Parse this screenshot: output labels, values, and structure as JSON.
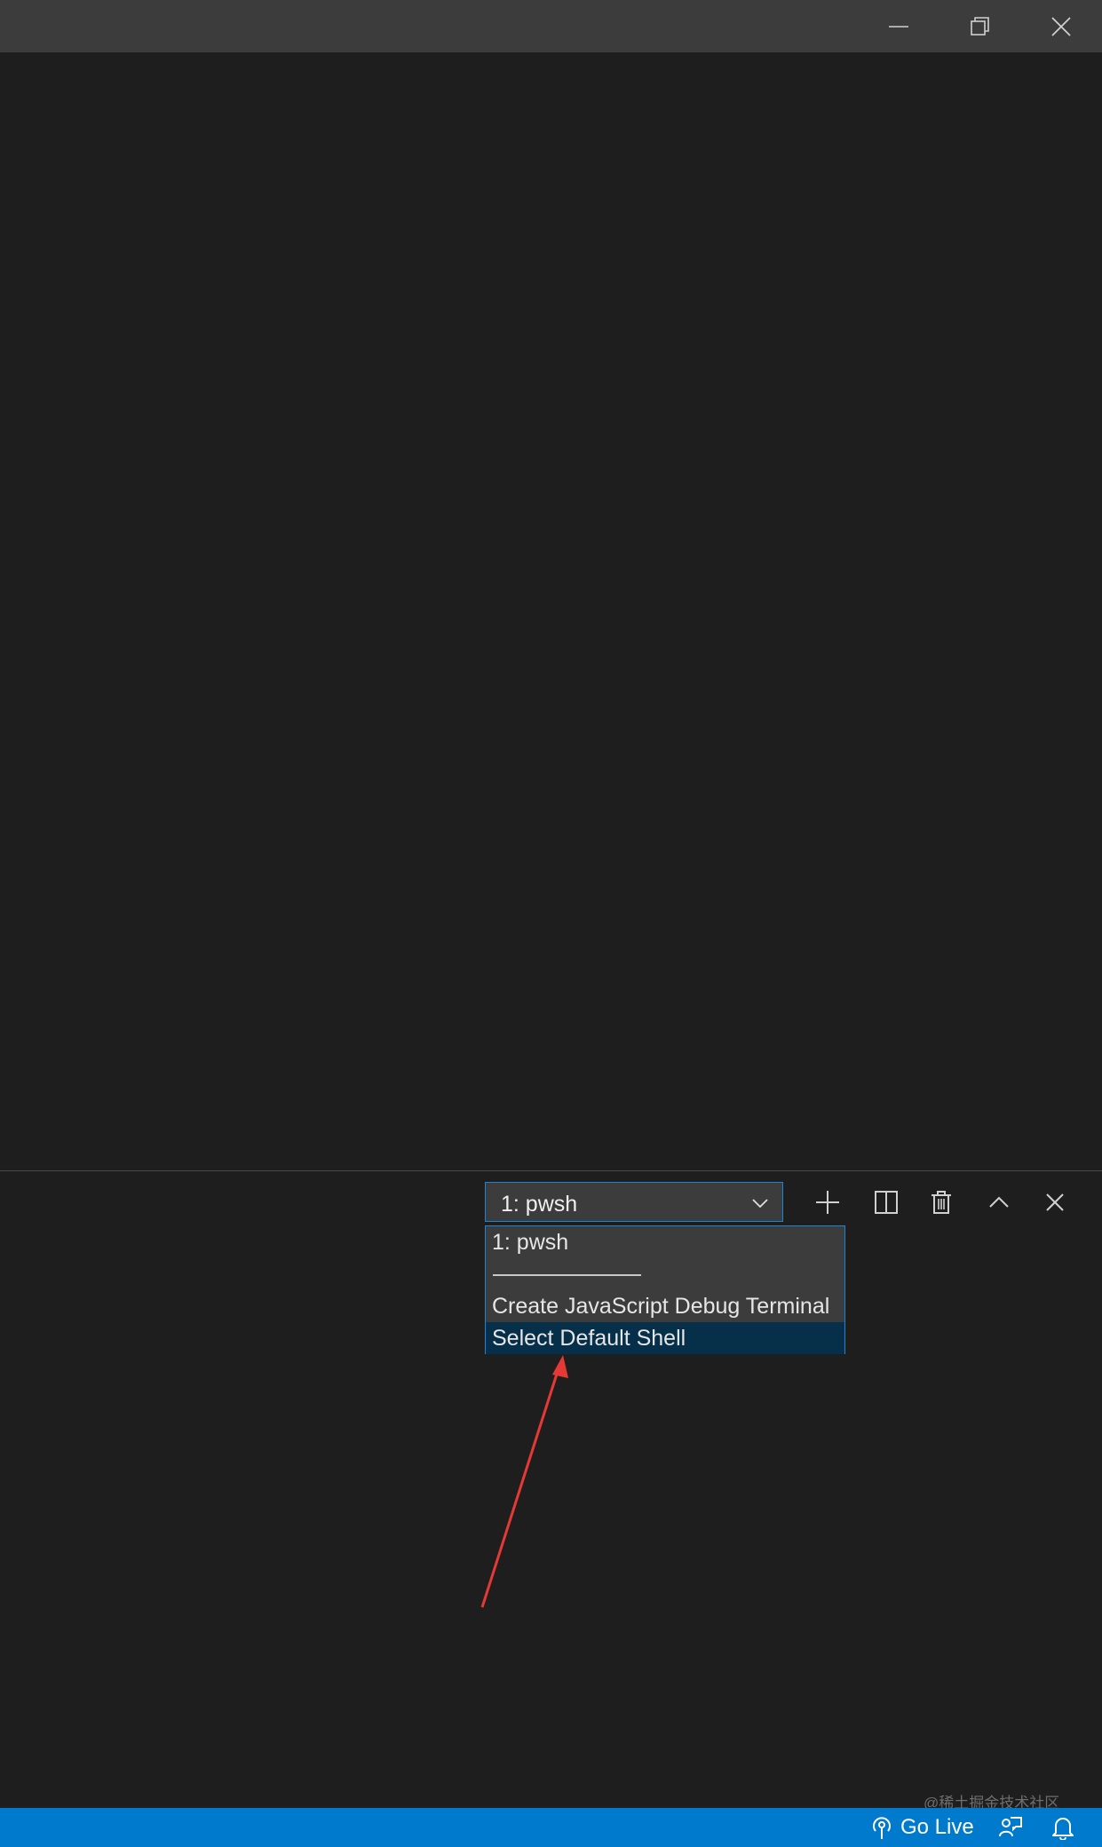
{
  "titlebar": {
    "minimize_icon": "minimize-icon",
    "restore_icon": "restore-icon",
    "close_icon": "close-icon"
  },
  "panel": {
    "terminal_select": {
      "value": "1: pwsh"
    },
    "dropdown": {
      "options": [
        "1: pwsh",
        "─────────",
        "Create JavaScript Debug Terminal",
        "Select Default Shell"
      ],
      "selected_index": 3
    },
    "actions": {
      "new_terminal": "plus-icon",
      "split_terminal": "split-icon",
      "kill_terminal": "trash-icon",
      "maximize_panel": "chevron-up-icon",
      "close_panel": "close-icon"
    }
  },
  "statusbar": {
    "go_live": "Go Live",
    "feedback_icon": "feedback-icon",
    "notifications_icon": "bell-icon"
  },
  "watermark": "@稀土掘金技术社区",
  "colors": {
    "titlebar": "#3c3c3c",
    "editor": "#1e1e1e",
    "accent": "#007acc",
    "focus_border": "#1a85d6",
    "selected_option": "#062f4a",
    "annotation_arrow": "#e53935"
  }
}
